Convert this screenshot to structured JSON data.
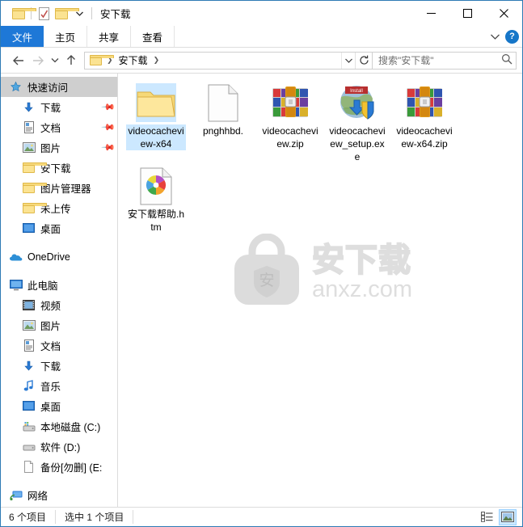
{
  "window": {
    "title": "安下载",
    "quick_access": [
      {
        "name": "folder-icon",
        "label": "文件资源管理器"
      },
      {
        "name": "properties-icon",
        "label": "属性"
      },
      {
        "name": "new-folder-icon",
        "label": "新建文件夹"
      },
      {
        "name": "customize-dropdown-icon",
        "label": "自定义快速访问工具栏"
      }
    ],
    "controls": {
      "minimize": "—",
      "maximize": "□",
      "close": "✕"
    }
  },
  "ribbon": {
    "tabs": [
      {
        "label": "文件",
        "active": true
      },
      {
        "label": "主页",
        "active": false
      },
      {
        "label": "共享",
        "active": false
      },
      {
        "label": "查看",
        "active": false
      }
    ],
    "collapse_icon": "⌄",
    "help_label": "?"
  },
  "address": {
    "back_icon": "←",
    "forward_icon": "→",
    "recent_icon": "⌄",
    "up_icon": "↑",
    "crumbs": [
      "安下载"
    ],
    "crumb_sep": "❯",
    "dropdown_icon": "⌄",
    "refresh_icon": "↻"
  },
  "search": {
    "placeholder": "搜索\"安下载\"",
    "icon": "search-icon"
  },
  "sidebar": {
    "groups": [
      {
        "items": [
          {
            "label": "快速访问",
            "icon": "star-pin-icon",
            "level": 0,
            "selected": true,
            "pinned": false
          },
          {
            "label": "下载",
            "icon": "download-arrow-icon",
            "level": 1,
            "selected": false,
            "pinned": true
          },
          {
            "label": "文档",
            "icon": "documents-icon",
            "level": 1,
            "selected": false,
            "pinned": true
          },
          {
            "label": "图片",
            "icon": "pictures-icon",
            "level": 1,
            "selected": false,
            "pinned": true
          },
          {
            "label": "安下载",
            "icon": "folder-icon",
            "level": 1,
            "selected": false,
            "pinned": false
          },
          {
            "label": "图片管理器",
            "icon": "folder-icon",
            "level": 1,
            "selected": false,
            "pinned": false
          },
          {
            "label": "未上传",
            "icon": "folder-icon",
            "level": 1,
            "selected": false,
            "pinned": false
          },
          {
            "label": "桌面",
            "icon": "desktop-icon",
            "level": 1,
            "selected": false,
            "pinned": false
          }
        ]
      },
      {
        "items": [
          {
            "label": "OneDrive",
            "icon": "onedrive-cloud-icon",
            "level": 0,
            "selected": false,
            "pinned": false
          }
        ]
      },
      {
        "items": [
          {
            "label": "此电脑",
            "icon": "this-pc-icon",
            "level": 0,
            "selected": false,
            "pinned": false
          },
          {
            "label": "视频",
            "icon": "videos-icon",
            "level": 1,
            "selected": false,
            "pinned": false
          },
          {
            "label": "图片",
            "icon": "pictures-icon",
            "level": 1,
            "selected": false,
            "pinned": false
          },
          {
            "label": "文档",
            "icon": "documents-icon",
            "level": 1,
            "selected": false,
            "pinned": false
          },
          {
            "label": "下载",
            "icon": "download-arrow-icon",
            "level": 1,
            "selected": false,
            "pinned": false
          },
          {
            "label": "音乐",
            "icon": "music-note-icon",
            "level": 1,
            "selected": false,
            "pinned": false
          },
          {
            "label": "桌面",
            "icon": "desktop-icon",
            "level": 1,
            "selected": false,
            "pinned": false
          },
          {
            "label": "本地磁盘 (C:)",
            "icon": "system-drive-icon",
            "level": 1,
            "selected": false,
            "pinned": false
          },
          {
            "label": "软件 (D:)",
            "icon": "drive-icon",
            "level": 1,
            "selected": false,
            "pinned": false
          },
          {
            "label": "备份[勿删] (E:",
            "icon": "drive-blank-icon",
            "level": 1,
            "selected": false,
            "pinned": false
          }
        ]
      },
      {
        "items": [
          {
            "label": "网络",
            "icon": "network-icon",
            "level": 0,
            "selected": false,
            "pinned": false
          }
        ]
      }
    ]
  },
  "files": [
    {
      "name": "videocacheview-x64",
      "icon": "folder-icon",
      "selected": true
    },
    {
      "name": "pnghhbd.",
      "icon": "blank-document-icon",
      "selected": false
    },
    {
      "name": "videocacheview.zip",
      "icon": "winrar-archive-icon",
      "selected": false
    },
    {
      "name": "videocacheview_setup.exe",
      "icon": "installer-exe-icon",
      "selected": false
    },
    {
      "name": "videocacheview-x64.zip",
      "icon": "winrar-archive-icon",
      "selected": false
    },
    {
      "name": "安下载帮助.htm",
      "icon": "html-document-icon",
      "selected": false
    }
  ],
  "watermark": {
    "logo": "anxz-bag-logo",
    "badge_char": "安",
    "cn_text": "安下载",
    "en_text": "anxz.com"
  },
  "statusbar": {
    "item_count": "6 个项目",
    "selection": "选中 1 个项目",
    "views": [
      {
        "name": "details-view-button",
        "active": false
      },
      {
        "name": "large-icons-view-button",
        "active": true
      }
    ]
  },
  "colors": {
    "accent": "#1e78d7",
    "selection": "#cce8ff",
    "window_border": "#2d7ab5",
    "folder_yellow": "#fbe392"
  }
}
